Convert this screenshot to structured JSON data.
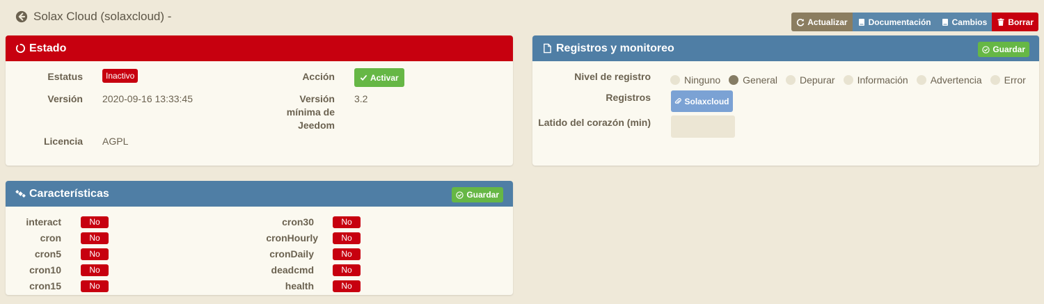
{
  "header": {
    "title": "Solax Cloud (solaxcloud) -",
    "buttons": {
      "refresh": "Actualizar",
      "docs": "Documentación",
      "changes": "Cambios",
      "delete": "Borrar"
    }
  },
  "status_panel": {
    "title": "Estado",
    "status_label": "Estatus",
    "status_value": "Inactivo",
    "action_label": "Acción",
    "action_button": "Activar",
    "version_label": "Versión",
    "version_value": "2020-09-16 13:33:45",
    "min_version_label_1": "Versión",
    "min_version_label_2": "mínima de",
    "min_version_label_3": "Jeedom",
    "min_version_value": "3.2",
    "license_label": "Licencia",
    "license_value": "AGPL"
  },
  "logs_panel": {
    "title": "Registros y monitoreo",
    "save": "Guardar",
    "log_level_label": "Nivel de registro",
    "log_levels": [
      "Ninguno",
      "General",
      "Depurar",
      "Información",
      "Advertencia",
      "Error"
    ],
    "selected_level": "General",
    "logs_label": "Registros",
    "log_button": "Solaxcloud",
    "heartbeat_label": "Latido del corazón (min)",
    "heartbeat_value": ""
  },
  "features_panel": {
    "title": "Características",
    "save": "Guardar",
    "left": [
      {
        "name": "interact",
        "value": "No"
      },
      {
        "name": "cron",
        "value": "No"
      },
      {
        "name": "cron5",
        "value": "No"
      },
      {
        "name": "cron10",
        "value": "No"
      },
      {
        "name": "cron15",
        "value": "No"
      }
    ],
    "right": [
      {
        "name": "cron30",
        "value": "No"
      },
      {
        "name": "cronHourly",
        "value": "No"
      },
      {
        "name": "cronDaily",
        "value": "No"
      },
      {
        "name": "deadcmd",
        "value": "No"
      },
      {
        "name": "health",
        "value": "No"
      }
    ]
  },
  "colors": {
    "background": "#efe9d9",
    "red": "#c7000f",
    "blue": "#4f7ea5",
    "green": "#66b745"
  }
}
